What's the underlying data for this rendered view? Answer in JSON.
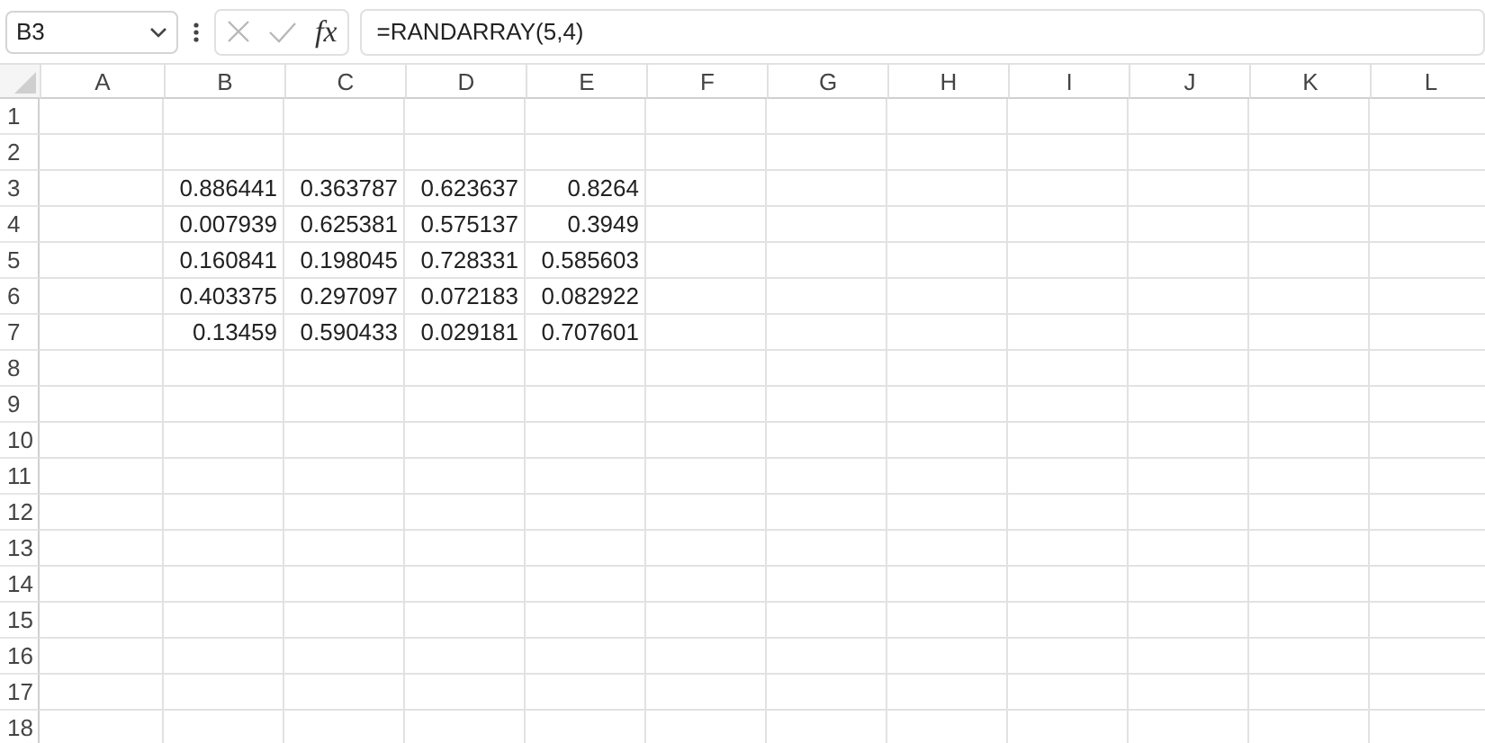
{
  "formula_bar": {
    "name_box": "B3",
    "fx_label": "fx",
    "formula": "=RANDARRAY(5,4)"
  },
  "sheet": {
    "columns": [
      "A",
      "B",
      "C",
      "D",
      "E",
      "F",
      "G",
      "H",
      "I",
      "J",
      "K",
      "L"
    ],
    "rows": [
      {
        "number": "1"
      },
      {
        "number": "2"
      },
      {
        "number": "3",
        "values": [
          "0.886441",
          "0.363787",
          "0.623637",
          "0.8264"
        ]
      },
      {
        "number": "4",
        "values": [
          "0.007939",
          "0.625381",
          "0.575137",
          "0.3949"
        ]
      },
      {
        "number": "5",
        "values": [
          "0.160841",
          "0.198045",
          "0.728331",
          "0.585603"
        ]
      },
      {
        "number": "6",
        "values": [
          "0.403375",
          "0.297097",
          "0.072183",
          "0.082922"
        ]
      },
      {
        "number": "7",
        "values": [
          "0.13459",
          "0.590433",
          "0.029181",
          "0.707601"
        ]
      },
      {
        "number": "8"
      },
      {
        "number": "9"
      },
      {
        "number": "10"
      },
      {
        "number": "11"
      },
      {
        "number": "12"
      },
      {
        "number": "13"
      },
      {
        "number": "14"
      },
      {
        "number": "15"
      },
      {
        "number": "16"
      },
      {
        "number": "17"
      },
      {
        "number": "18"
      }
    ]
  }
}
